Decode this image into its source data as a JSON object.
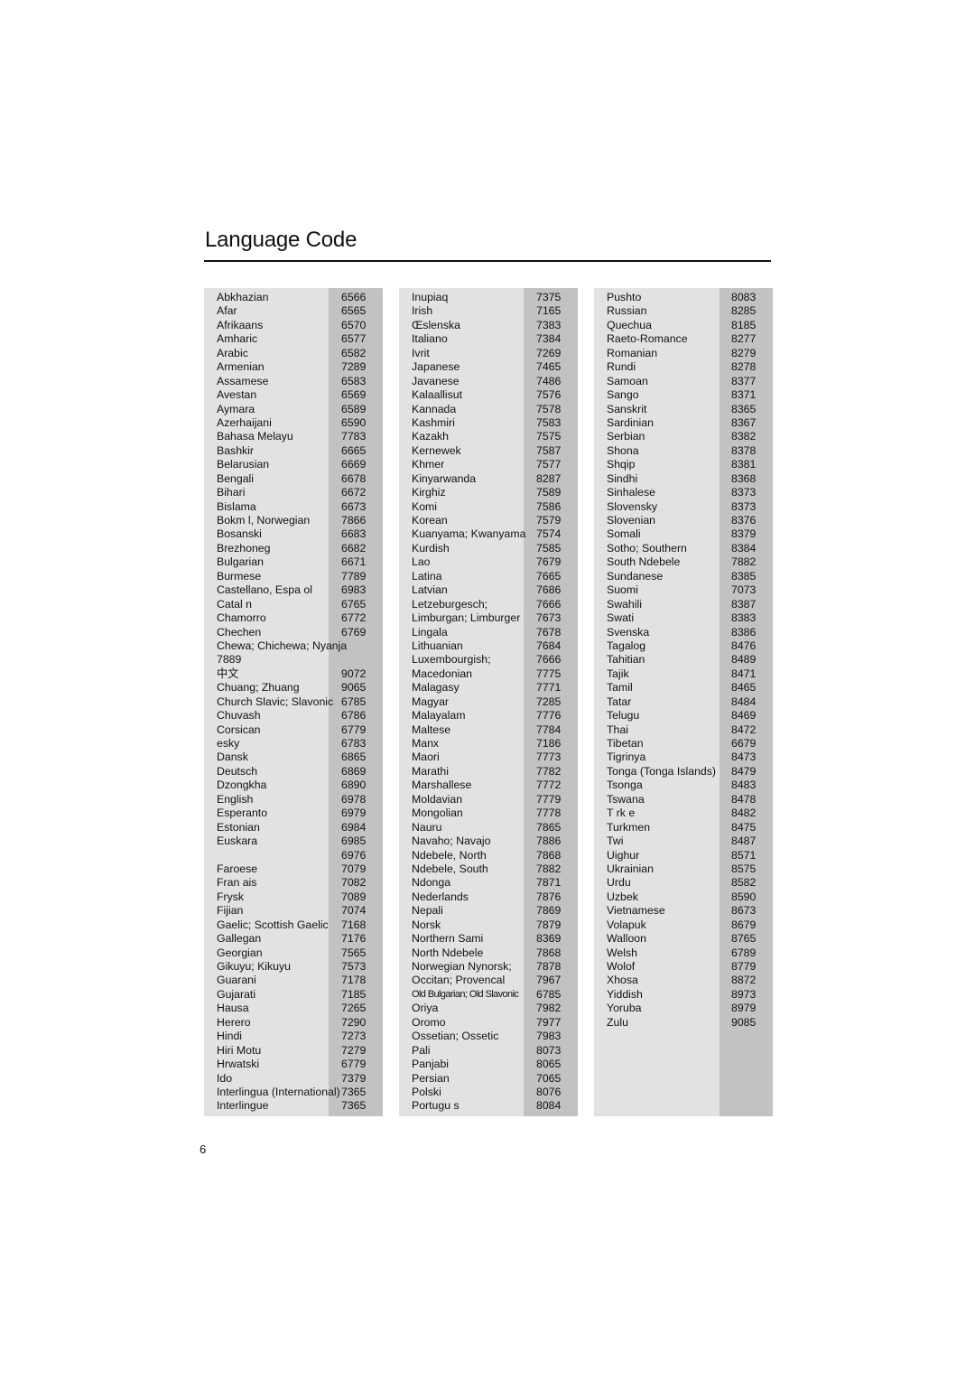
{
  "title": "Language Code",
  "page_number": "6",
  "colors": {
    "panel_bg": "#e2e2e2",
    "code_column_bg": "#c2c2c2",
    "text": "#111111"
  },
  "columns": [
    {
      "rows": [
        {
          "name": "Abkhazian",
          "code": "6566"
        },
        {
          "name": "Afar",
          "code": "6565"
        },
        {
          "name": "Afrikaans",
          "code": "6570"
        },
        {
          "name": "Amharic",
          "code": "6577"
        },
        {
          "name": "Arabic",
          "code": "6582"
        },
        {
          "name": "Armenian",
          "code": "7289"
        },
        {
          "name": "Assamese",
          "code": "6583"
        },
        {
          "name": "Avestan",
          "code": "6569"
        },
        {
          "name": "Aymara",
          "code": "6589"
        },
        {
          "name": "Azerhaijani",
          "code": "6590"
        },
        {
          "name": "Bahasa Melayu",
          "code": "7783"
        },
        {
          "name": "Bashkir",
          "code": "6665"
        },
        {
          "name": "Belarusian",
          "code": "6669"
        },
        {
          "name": "Bengali",
          "code": "6678"
        },
        {
          "name": "Bihari",
          "code": "6672"
        },
        {
          "name": "Bislama",
          "code": "6673"
        },
        {
          "name": "Bokm l, Norwegian",
          "code": "7866"
        },
        {
          "name": "Bosanski",
          "code": "6683"
        },
        {
          "name": "Brezhoneg",
          "code": "6682"
        },
        {
          "name": "Bulgarian",
          "code": "6671"
        },
        {
          "name": "Burmese",
          "code": "7789"
        },
        {
          "name": "Castellano, Espa ol",
          "code": "6983"
        },
        {
          "name": "Catal n",
          "code": "6765"
        },
        {
          "name": "Chamorro",
          "code": "6772"
        },
        {
          "name": "Chechen",
          "code": "6769"
        },
        {
          "name": "Chewa; Chichewa; Nyanja",
          "code": "7889",
          "wrap": true
        },
        {
          "name": "中文",
          "code": "9072"
        },
        {
          "name": "Chuang; Zhuang",
          "code": "9065"
        },
        {
          "name": "Church Slavic; Slavonic",
          "code": "6785"
        },
        {
          "name": "Chuvash",
          "code": "6786"
        },
        {
          "name": "Corsican",
          "code": "6779"
        },
        {
          "name": " esky",
          "code": "6783"
        },
        {
          "name": "Dansk",
          "code": "6865"
        },
        {
          "name": "Deutsch",
          "code": "6869"
        },
        {
          "name": "Dzongkha",
          "code": "6890"
        },
        {
          "name": "English",
          "code": "6978"
        },
        {
          "name": "Esperanto",
          "code": "6979"
        },
        {
          "name": "Estonian",
          "code": "6984"
        },
        {
          "name": "Euskara",
          "code": "6985"
        },
        {
          "name": "",
          "code": "6976"
        },
        {
          "name": "Faroese",
          "code": "7079"
        },
        {
          "name": "Fran ais",
          "code": "7082"
        },
        {
          "name": "Frysk",
          "code": "7089"
        },
        {
          "name": "Fijian",
          "code": "7074"
        },
        {
          "name": "Gaelic; Scottish Gaelic",
          "code": "7168"
        },
        {
          "name": "Gallegan",
          "code": "7176"
        },
        {
          "name": "Georgian",
          "code": "7565"
        },
        {
          "name": "Gikuyu; Kikuyu",
          "code": "7573"
        },
        {
          "name": "Guarani",
          "code": "7178"
        },
        {
          "name": "Gujarati",
          "code": "7185"
        },
        {
          "name": "Hausa",
          "code": "7265"
        },
        {
          "name": "Herero",
          "code": "7290"
        },
        {
          "name": "Hindi",
          "code": "7273"
        },
        {
          "name": "Hiri Motu",
          "code": "7279"
        },
        {
          "name": "Hrwatski",
          "code": "6779"
        },
        {
          "name": "Ido",
          "code": "7379"
        },
        {
          "name": "Interlingua (International)",
          "code": "7365"
        },
        {
          "name": "Interlingue",
          "code": "7365"
        }
      ]
    },
    {
      "rows": [
        {
          "name": "Inupiaq",
          "code": "7375"
        },
        {
          "name": "Irish",
          "code": "7165"
        },
        {
          "name": "Œslenska",
          "code": "7383"
        },
        {
          "name": "Italiano",
          "code": "7384"
        },
        {
          "name": "Ivrit",
          "code": "7269"
        },
        {
          "name": "Japanese",
          "code": "7465"
        },
        {
          "name": "Javanese",
          "code": "7486"
        },
        {
          "name": "Kalaallisut",
          "code": "7576"
        },
        {
          "name": "Kannada",
          "code": "7578"
        },
        {
          "name": "Kashmiri",
          "code": "7583"
        },
        {
          "name": "Kazakh",
          "code": "7575"
        },
        {
          "name": "Kernewek",
          "code": "7587"
        },
        {
          "name": "Khmer",
          "code": "7577"
        },
        {
          "name": "Kinyarwanda",
          "code": "8287"
        },
        {
          "name": "Kirghiz",
          "code": "7589"
        },
        {
          "name": "Komi",
          "code": "7586"
        },
        {
          "name": "Korean",
          "code": "7579"
        },
        {
          "name": "Kuanyama; Kwanyama",
          "code": "7574"
        },
        {
          "name": "Kurdish",
          "code": "7585"
        },
        {
          "name": "Lao",
          "code": "7679"
        },
        {
          "name": "Latina",
          "code": "7665"
        },
        {
          "name": "Latvian",
          "code": "7686"
        },
        {
          "name": "Letzeburgesch;",
          "code": "7666"
        },
        {
          "name": "Limburgan; Limburger",
          "code": "7673"
        },
        {
          "name": "Lingala",
          "code": "7678"
        },
        {
          "name": "Lithuanian",
          "code": "7684"
        },
        {
          "name": "Luxembourgish;",
          "code": "7666"
        },
        {
          "name": "Macedonian",
          "code": "7775"
        },
        {
          "name": "Malagasy",
          "code": "7771"
        },
        {
          "name": "Magyar",
          "code": "7285"
        },
        {
          "name": "Malayalam",
          "code": "7776"
        },
        {
          "name": "Maltese",
          "code": "7784"
        },
        {
          "name": "Manx",
          "code": "7186"
        },
        {
          "name": "Maori",
          "code": "7773"
        },
        {
          "name": "Marathi",
          "code": "7782"
        },
        {
          "name": "Marshallese",
          "code": "7772"
        },
        {
          "name": "Moldavian",
          "code": "7779"
        },
        {
          "name": "Mongolian",
          "code": "7778"
        },
        {
          "name": "Nauru",
          "code": "7865"
        },
        {
          "name": "Navaho; Navajo",
          "code": "7886"
        },
        {
          "name": "Ndebele, North",
          "code": "7868"
        },
        {
          "name": "Ndebele, South",
          "code": "7882"
        },
        {
          "name": "Ndonga",
          "code": "7871"
        },
        {
          "name": "Nederlands",
          "code": "7876"
        },
        {
          "name": "Nepali",
          "code": "7869"
        },
        {
          "name": "Norsk",
          "code": "7879"
        },
        {
          "name": "Northern Sami",
          "code": "8369"
        },
        {
          "name": "North Ndebele",
          "code": "7868"
        },
        {
          "name": "Norwegian Nynorsk;",
          "code": "7878"
        },
        {
          "name": "Occitan; Provencal",
          "code": "7967"
        },
        {
          "name": "Old Bulgarian; Old Slavonic",
          "code": "6785",
          "small": true
        },
        {
          "name": "Oriya",
          "code": "7982"
        },
        {
          "name": "Oromo",
          "code": "7977"
        },
        {
          "name": "Ossetian; Ossetic",
          "code": "7983"
        },
        {
          "name": "Pali",
          "code": "8073"
        },
        {
          "name": "Panjabi",
          "code": "8065"
        },
        {
          "name": "Persian",
          "code": "7065"
        },
        {
          "name": "Polski",
          "code": "8076"
        },
        {
          "name": "Portugu s",
          "code": "8084"
        }
      ]
    },
    {
      "rows": [
        {
          "name": "Pushto",
          "code": "8083"
        },
        {
          "name": "Russian",
          "code": "8285"
        },
        {
          "name": "Quechua",
          "code": "8185"
        },
        {
          "name": "Raeto-Romance",
          "code": "8277"
        },
        {
          "name": "Romanian",
          "code": "8279"
        },
        {
          "name": "Rundi",
          "code": "8278"
        },
        {
          "name": "Samoan",
          "code": "8377"
        },
        {
          "name": "Sango",
          "code": "8371"
        },
        {
          "name": "Sanskrit",
          "code": "8365"
        },
        {
          "name": "Sardinian",
          "code": "8367"
        },
        {
          "name": "Serbian",
          "code": "8382"
        },
        {
          "name": "Shona",
          "code": "8378"
        },
        {
          "name": "Shqip",
          "code": "8381"
        },
        {
          "name": "Sindhi",
          "code": "8368"
        },
        {
          "name": "Sinhalese",
          "code": "8373"
        },
        {
          "name": "Slovensky",
          "code": "8373"
        },
        {
          "name": "Slovenian",
          "code": "8376"
        },
        {
          "name": "Somali",
          "code": "8379"
        },
        {
          "name": "Sotho; Southern",
          "code": "8384"
        },
        {
          "name": "South Ndebele",
          "code": "7882"
        },
        {
          "name": "Sundanese",
          "code": "8385"
        },
        {
          "name": "Suomi",
          "code": "7073"
        },
        {
          "name": "Swahili",
          "code": "8387"
        },
        {
          "name": "Swati",
          "code": "8383"
        },
        {
          "name": "Svenska",
          "code": "8386"
        },
        {
          "name": "Tagalog",
          "code": "8476"
        },
        {
          "name": "Tahitian",
          "code": "8489"
        },
        {
          "name": "Tajik",
          "code": "8471"
        },
        {
          "name": "Tamil",
          "code": "8465"
        },
        {
          "name": "Tatar",
          "code": "8484"
        },
        {
          "name": "Telugu",
          "code": "8469"
        },
        {
          "name": "Thai",
          "code": "8472"
        },
        {
          "name": "Tibetan",
          "code": "6679"
        },
        {
          "name": "Tigrinya",
          "code": "8473"
        },
        {
          "name": "Tonga (Tonga Islands)",
          "code": "8479"
        },
        {
          "name": "Tsonga",
          "code": "8483"
        },
        {
          "name": "Tswana",
          "code": "8478"
        },
        {
          "name": "T rk e",
          "code": "8482"
        },
        {
          "name": "Turkmen",
          "code": "8475"
        },
        {
          "name": "Twi",
          "code": "8487"
        },
        {
          "name": "Uighur",
          "code": "8571"
        },
        {
          "name": "Ukrainian",
          "code": "8575"
        },
        {
          "name": "Urdu",
          "code": "8582"
        },
        {
          "name": "Uzbek",
          "code": "8590"
        },
        {
          "name": "Vietnamese",
          "code": "8673"
        },
        {
          "name": "Volapuk",
          "code": "8679"
        },
        {
          "name": "Walloon",
          "code": "8765"
        },
        {
          "name": "Welsh",
          "code": "6789"
        },
        {
          "name": "Wolof",
          "code": "8779"
        },
        {
          "name": "Xhosa",
          "code": "8872"
        },
        {
          "name": "Yiddish",
          "code": "8973"
        },
        {
          "name": "Yoruba",
          "code": "8979"
        },
        {
          "name": "Zulu",
          "code": "9085"
        }
      ]
    }
  ]
}
